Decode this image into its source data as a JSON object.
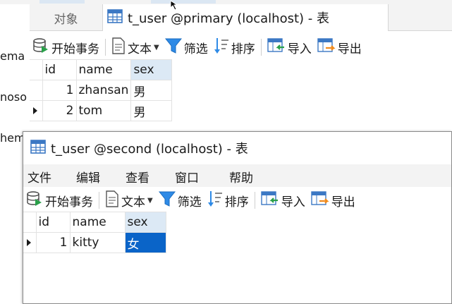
{
  "sidebar": {
    "partial_items": [
      "ema",
      "noso",
      "hem"
    ]
  },
  "back_window": {
    "tabs": [
      {
        "label": "对象"
      },
      {
        "label": "t_user @primary (localhost) - 表"
      }
    ],
    "toolbar": {
      "begin_transaction": "开始事务",
      "text": "文本",
      "filter": "筛选",
      "sort": "排序",
      "import": "导入",
      "export": "导出"
    },
    "table": {
      "columns": [
        "id",
        "name",
        "sex"
      ],
      "rows": [
        {
          "id": "1",
          "name": "zhansan",
          "sex": "男"
        },
        {
          "id": "2",
          "name": "tom",
          "sex": "男"
        }
      ]
    }
  },
  "front_window": {
    "title": "t_user @second (localhost) - 表",
    "menu": [
      "文件",
      "编辑",
      "查看",
      "窗口",
      "帮助"
    ],
    "toolbar": {
      "begin_transaction": "开始事务",
      "text": "文本",
      "filter": "筛选",
      "sort": "排序",
      "import": "导入",
      "export": "导出"
    },
    "table": {
      "columns": [
        "id",
        "name",
        "sex"
      ],
      "rows": [
        {
          "id": "1",
          "name": "kitty",
          "sex": "女"
        }
      ]
    }
  },
  "colors": {
    "selection": "#0a64c8",
    "header_highlight": "#dce9f5",
    "menu_bg": "#f3f3f3"
  },
  "icons": [
    "table-icon",
    "database-transaction-icon",
    "document-text-icon",
    "funnel-filter-icon",
    "sort-icon",
    "import-icon",
    "export-icon",
    "row-pointer-icon",
    "mouse-cursor-icon"
  ]
}
